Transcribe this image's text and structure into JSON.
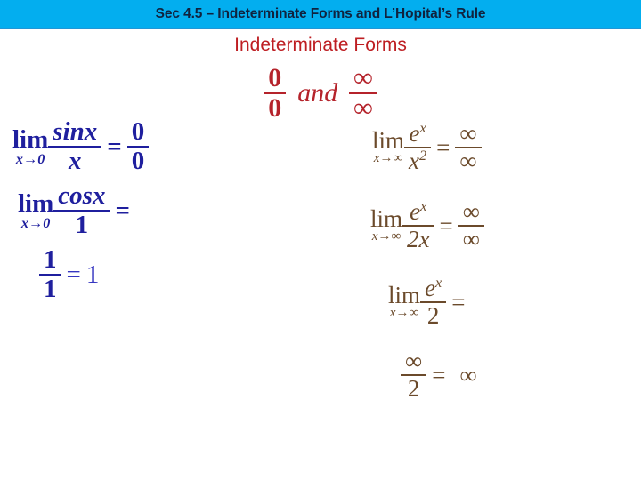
{
  "header": {
    "title": "Sec 4.5 – Indeterminate Forms and L’Hopital’s Rule",
    "bar_color": "#03AEEF",
    "title_color": "#10233f"
  },
  "subtitle": {
    "text": "Indeterminate Forms",
    "color": "#BE1E22"
  },
  "forms": {
    "color": "#B5232B",
    "first": {
      "num": "0",
      "den": "0"
    },
    "conjunction": "and",
    "second": {
      "num": "∞",
      "den": "∞"
    }
  },
  "left_column": {
    "color": "#1F1F9E",
    "expr1": {
      "lim_main": "lim",
      "lim_sub": "x→0",
      "num": "sinx",
      "den": "x",
      "equals": "=",
      "result_num": "0",
      "result_den": "0"
    },
    "expr2": {
      "lim_main": "lim",
      "lim_sub": "x→0",
      "num": "cosx",
      "den": "1",
      "equals": "="
    },
    "expr3": {
      "num": "1",
      "den": "1",
      "equals": "=",
      "result": "1"
    }
  },
  "right_column": {
    "color": "#6B4A2B",
    "expr1": {
      "lim_main": "lim",
      "lim_sub": "x→∞",
      "num_base": "e",
      "num_exp": "x",
      "den_base": "x",
      "den_exp": "2",
      "equals": "=",
      "result_num": "∞",
      "result_den": "∞"
    },
    "expr2": {
      "lim_main": "lim",
      "lim_sub": "x→∞",
      "num_base": "e",
      "num_exp": "x",
      "den": "2x",
      "equals": "=",
      "result_num": "∞",
      "result_den": "∞"
    },
    "expr3": {
      "lim_main": "lim",
      "lim_sub": "x→∞",
      "num_base": "e",
      "num_exp": "x",
      "den": "2",
      "equals": "="
    },
    "expr4": {
      "num": "∞",
      "den": "2",
      "equals": "=",
      "result": "∞"
    }
  }
}
